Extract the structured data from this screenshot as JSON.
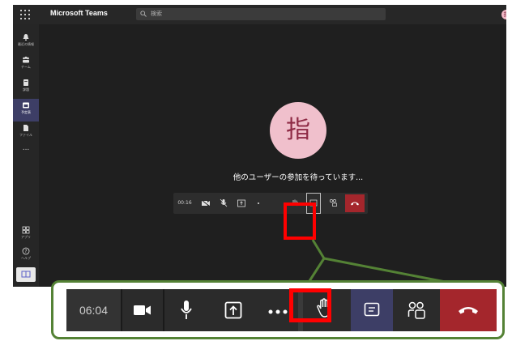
{
  "app": {
    "name": "Microsoft Teams",
    "avatar_initial": "指"
  },
  "search": {
    "placeholder": "検索"
  },
  "left_rail": {
    "items": [
      {
        "label": "最近の情報",
        "icon": "bell-icon"
      },
      {
        "label": "チーム",
        "icon": "teams-icon"
      },
      {
        "label": "課題",
        "icon": "assignments-icon"
      },
      {
        "label": "予定表",
        "icon": "calendar-icon",
        "active": true
      },
      {
        "label": "ファイル",
        "icon": "file-icon"
      }
    ],
    "more": "...",
    "bottom_items": [
      {
        "label": "アプリ",
        "icon": "apps-icon"
      },
      {
        "label": "ヘルプ",
        "icon": "help-icon"
      }
    ]
  },
  "meeting": {
    "participant_initial": "指",
    "waiting_text": "他のユーザーの参加を待っています..."
  },
  "call_bar_small": {
    "timer": "00:16"
  },
  "call_bar_zoom": {
    "timer": "06:04"
  },
  "colors": {
    "highlight": "#ff0000",
    "callout": "#548235",
    "end_call": "#a4262c",
    "chat_active": "#3d3e66"
  }
}
